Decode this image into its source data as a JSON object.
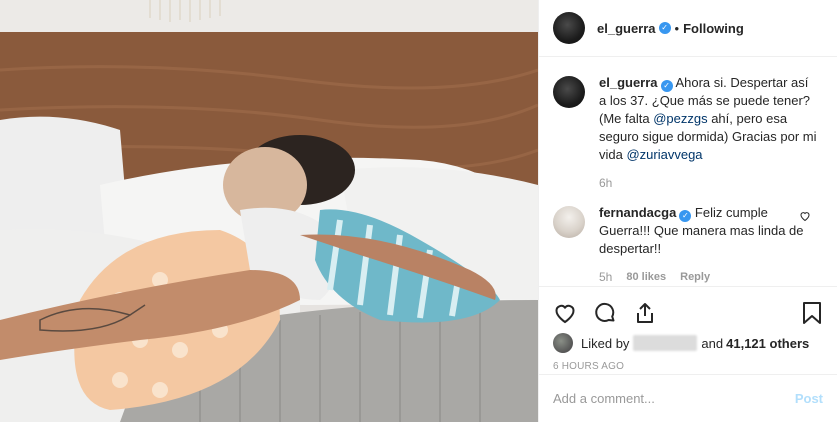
{
  "post": {
    "author": "el_guerra",
    "follow_state": "Following",
    "dot": "•"
  },
  "caption": {
    "author": "el_guerra",
    "text_before": " Ahora si. Despertar así a los 37. ¿Que más se puede tener? (Me falta ",
    "mention1": "@pezzgs",
    "text_middle": " ahí, pero esa seguro sigue dormida) Gracias por mi vida ",
    "mention2": "@zuriavvega",
    "age": "6h"
  },
  "comment": {
    "author": "fernandacga",
    "text": " Feliz cumple Guerra!!! Que manera mas linda de despertar!!",
    "age": "5h",
    "likes": "80 likes",
    "reply": "Reply"
  },
  "likes": {
    "prefix": "Liked by",
    "count": "41,121 others",
    "and": "and"
  },
  "timestamp": "6 HOURS AGO",
  "add_comment": {
    "placeholder": "Add a comment...",
    "post_label": "Post"
  },
  "icons": {
    "verified": "verified-badge",
    "like": "heart-icon",
    "comment": "comment-icon",
    "share": "share-icon",
    "save": "bookmark-icon"
  },
  "colors": {
    "accent": "#3897f0",
    "mention": "#003569",
    "muted": "#999999",
    "post_disabled": "#b2dffc"
  }
}
